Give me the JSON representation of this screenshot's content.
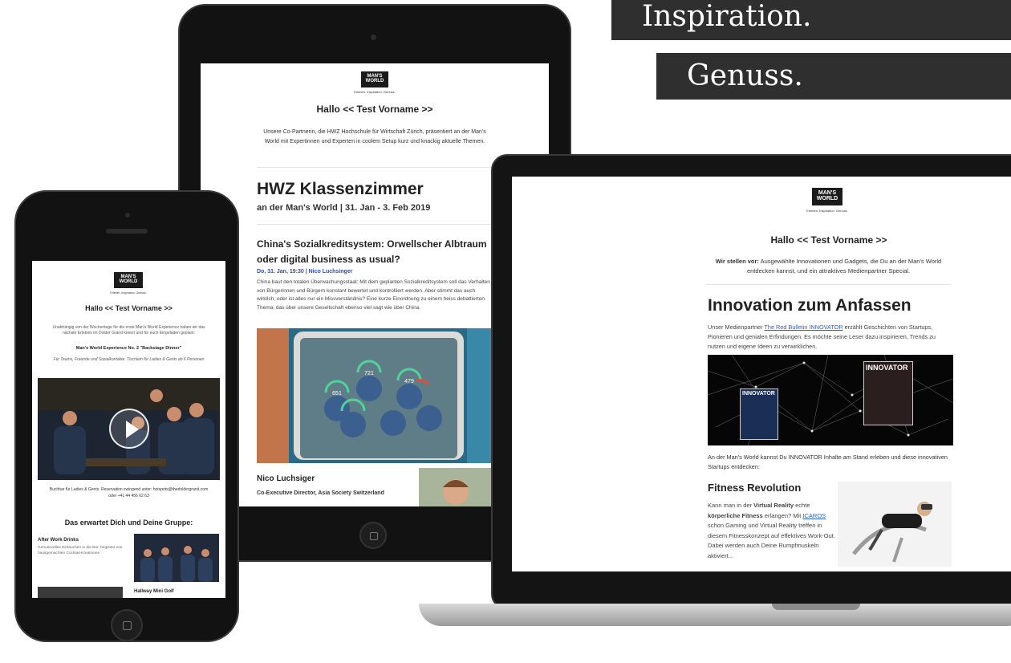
{
  "banners": {
    "inspiration": "Inspiration.",
    "genuss": "Genuss."
  },
  "logo": {
    "text": "MAN'S WORLD",
    "tagline": "Erleben. Inspiration. Genuss."
  },
  "tablet": {
    "hello": "Hallo << Test Vorname >>",
    "intro": "Unsere Co-Partnerin, die HWZ Hochschule für Wirtschaft Zürich, präsentiert an der Man's World mit Expertinnen und Experten in coolem Setup kurz und knackig aktuelle Themen.",
    "headline": "HWZ Klassenzimmer",
    "headline_sub": "an der Man's World | 31. Jan - 3. Feb 2019",
    "article_title": "China's Sozialkreditsystem: Orwellscher Albtraum oder digital business as usual?",
    "article_meta": "Do, 31. Jan, 19:30 | Nico Luchsinger",
    "article_body": "China baut den totalen Überwachungsstaat: Mit dem geplanten Sozialkreditsystem soll das Verhalten von Bürgerinnen und Bürgern konstant bewertet und kontrolliert werden. Aber stimmt das auch wirklich, oder ist alles nur ein Missverständnis? Eine kurze Einordnung zu einem heiss debattierten Thema, das über unsere Gesellschaft ebenso viel sagt wie über China.",
    "scores": [
      "721",
      "651",
      "479"
    ],
    "person_name": "Nico Luchsiger",
    "person_role": "Co-Executive Director, Asia Society Switzerland"
  },
  "phone": {
    "hello": "Hallo << Test Vorname >>",
    "intro": "Unabhängig von der Wochentage für die erste Man's World Experience haben wir das nächste Erlebnis im Dolder Grand kreiert und für euch Eingeladen geplant:",
    "event_title": "Man's World Experience No. 2 \"Backstage Dinner\"",
    "event_sub": "Für Teams, Freunde und Sozialkontakte. Tischlein für Ladies & Gents ab 6 Personen",
    "booking": "Buchbar für Ladies & Gents. Reservation zwingend unter: hotspots@thedoldergrand.com oder +41 44 456 62 63",
    "section_title": "Das erwartet Dich und Deine Gruppe:",
    "item1_title": "After Work Drinks",
    "item1_body": "Genussvolles Eintauchen in die Bar, begleitet von hausgemachten Cocktail-Kreationen",
    "item2_title": "Hallway Mini Golf"
  },
  "laptop": {
    "hello": "Hallo << Test Vorname >>",
    "intro_bold": "Wir stellen vor:",
    "intro": "Ausgewählte Innovationen und Gadgets, die Du an der Man's World entdecken kannst, und ein attraktives Medienpartner Special.",
    "headline": "Innovation zum Anfassen",
    "p1_prefix": "Unser Medienpartner",
    "p1_link": "The Red Bulletin INNOVATOR",
    "p1_rest": "erzählt Geschichten von Startups, Pionieren und genialen Erfindungen. Es möchte seine Leser dazu inspirieren, Trends zu nutzen und eigene Ideen zu verwirklichen.",
    "magazine_label": "INNOVATOR",
    "p2": "An der Man's World kannst Du INNOVATOR Inhalte am Stand erleben und diese innovativen Startups entdecken:",
    "h2": "Fitness Revolution",
    "p3_a": "Kann man in der",
    "p3_b": "Virtual Reality",
    "p3_c": "echte",
    "p3_d": "körperliche Fitness",
    "p3_e": "erlangen? Mit",
    "p3_link": "ICAROS",
    "p3_f": "schon Gaming und Virtual Reality treffen in diesem Fitnesskonzept auf effektives Work-Out. Dabei werden auch Deine Rumpfmuskeln aktiviert..."
  },
  "colors": {
    "banner_bg": "#2f2f30",
    "device_body": "#121212",
    "link": "#2a5fc7"
  }
}
